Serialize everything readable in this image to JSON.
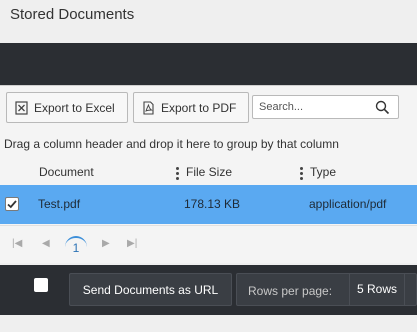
{
  "page": {
    "title": "Stored Documents"
  },
  "toolbar": {
    "export_excel_label": "Export to Excel",
    "export_pdf_label": "Export to PDF",
    "search_placeholder": "Search..."
  },
  "grid": {
    "group_hint": "Drag a column header and drop it here to group by that column",
    "columns": [
      "Document",
      "File Size",
      "Type"
    ],
    "rows": [
      {
        "selected": true,
        "document": "Test.pdf",
        "file_size": "178.13 KB",
        "type": "application/pdf"
      }
    ],
    "pager": {
      "current_page": "1"
    }
  },
  "footer": {
    "send_label": "Send Documents as URL",
    "rows_per_page_label": "Rows per page:",
    "rows_per_page_value": "5 Rows"
  },
  "colors": {
    "selected_row": "#5aa9f1",
    "bar_dark": "#2b2e33",
    "accent": "#3d8fd9"
  }
}
